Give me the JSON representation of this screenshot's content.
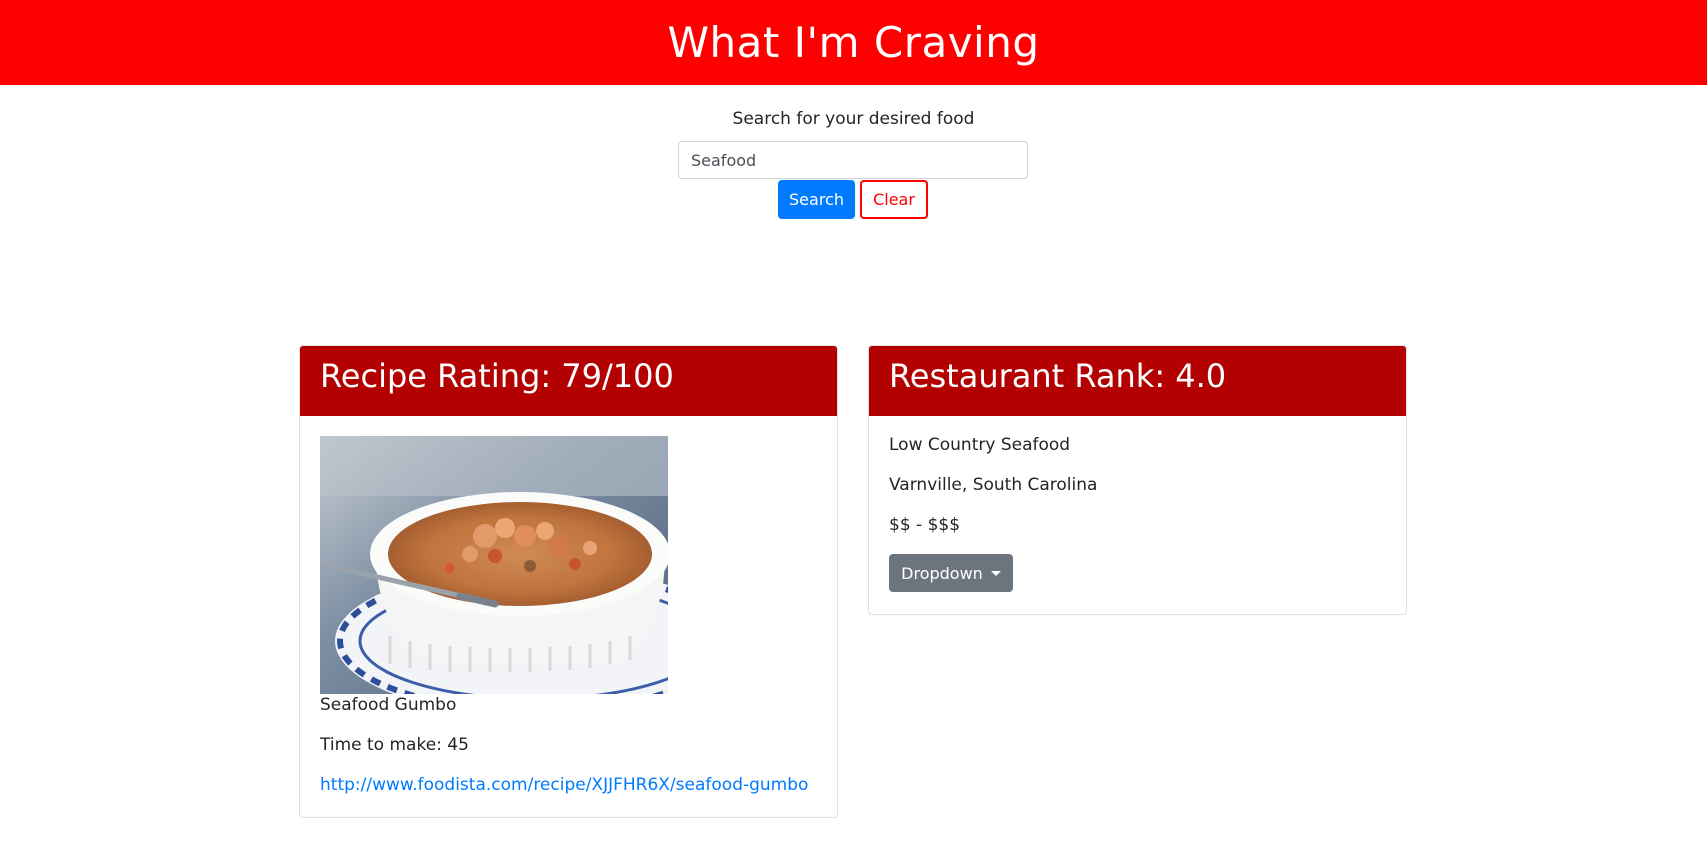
{
  "header": {
    "title": "What I'm Craving",
    "background_color": "#ff0000"
  },
  "search": {
    "label": "Search for your desired food",
    "value": "Seafood",
    "search_button": "Search",
    "clear_button": "Clear",
    "search_button_color": "#007bff",
    "clear_button_color": "#ff0000"
  },
  "recipe_card": {
    "title": "Recipe Rating: 79/100",
    "header_color": "#b30000",
    "image_icon": "seafood-gumbo-photo",
    "name": "Seafood Gumbo",
    "time": "Time to make: 45",
    "link": "http://www.foodista.com/recipe/XJJFHR6X/seafood-gumbo"
  },
  "restaurant_card": {
    "title": "Restaurant Rank: 4.0",
    "header_color": "#b30000",
    "name": "Low Country Seafood",
    "location": "Varnville, South Carolina",
    "price": "$$ - $$$",
    "dropdown_label": "Dropdown",
    "dropdown_icon": "caret-down-icon"
  }
}
